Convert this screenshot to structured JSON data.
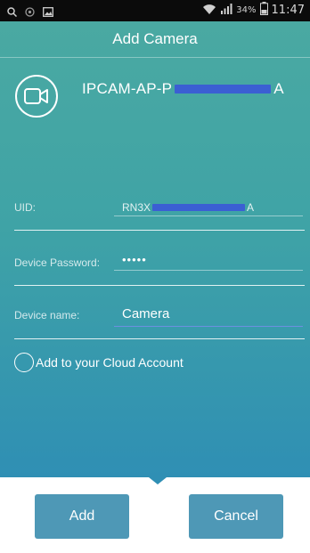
{
  "status_bar": {
    "battery_percent": "34%",
    "time": "11:47",
    "icons": [
      "search-icon",
      "notification-icon",
      "image-icon",
      "wifi-icon",
      "signal-icon",
      "battery-icon"
    ]
  },
  "header": {
    "title": "Add Camera"
  },
  "device": {
    "icon": "video-camera-icon",
    "id_prefix": "IPCAM-AP-P",
    "id_suffix": "A"
  },
  "form": {
    "uid": {
      "label": "UID:",
      "value_prefix": "RN3X",
      "value_suffix": "A"
    },
    "password": {
      "label": "Device Password:",
      "value": "•••••"
    },
    "name": {
      "label": "Device name:",
      "value": "Camera"
    },
    "cloud": {
      "label": "Add to your Cloud Account",
      "checked": false
    }
  },
  "buttons": {
    "add": "Add",
    "cancel": "Cancel"
  },
  "colors": {
    "accent": "#4aa9a2",
    "button": "#4e98b6",
    "redaction": "#3b5fd3"
  }
}
